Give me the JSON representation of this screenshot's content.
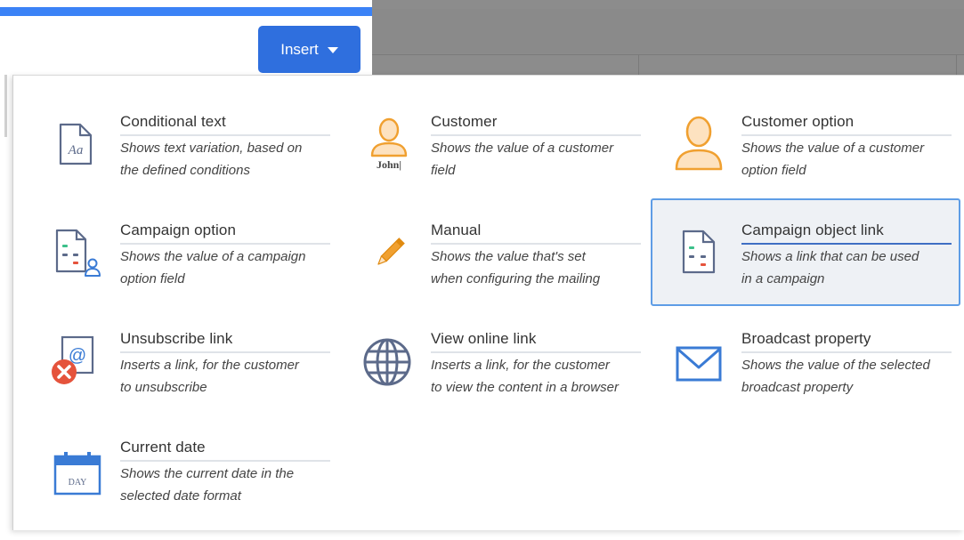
{
  "toolbar": {
    "insert_label": "Insert"
  },
  "menu": {
    "items": [
      {
        "title": "Conditional text",
        "desc_line1": "Shows text variation, based on",
        "desc_line2": "the defined conditions",
        "icon": "document-aa-icon"
      },
      {
        "title": "Customer",
        "desc_line1": "Shows the value of a customer",
        "desc_line2": "field",
        "icon": "person-name-icon",
        "icon_text": "John|"
      },
      {
        "title": "Customer option",
        "desc_line1": "Shows the value of a customer",
        "desc_line2": "option field",
        "icon": "person-icon"
      },
      {
        "title": "Campaign option",
        "desc_line1": "Shows the value of a campaign",
        "desc_line2": "option field",
        "icon": "campaign-document-user-icon"
      },
      {
        "title": "Manual",
        "desc_line1": "Shows the value that's set",
        "desc_line2": "when configuring the mailing",
        "icon": "pencil-icon"
      },
      {
        "title": "Campaign object link",
        "desc_line1": "Shows a link that can be used",
        "desc_line2": "in a campaign",
        "icon": "campaign-document-icon",
        "selected": true
      },
      {
        "title": "Unsubscribe link",
        "desc_line1": "Inserts a link, for the customer",
        "desc_line2": "to unsubscribe",
        "icon": "unsubscribe-icon"
      },
      {
        "title": "View online link",
        "desc_line1": "Inserts a link, for the customer",
        "desc_line2": "to view the content in a browser",
        "icon": "globe-icon"
      },
      {
        "title": "Broadcast property",
        "desc_line1": "Shows the value of the selected",
        "desc_line2": "broadcast property",
        "icon": "envelope-icon"
      },
      {
        "title": "Current date",
        "desc_line1": "Shows the current date in the",
        "desc_line2": "selected date format",
        "icon": "calendar-icon",
        "icon_text": "DAY"
      }
    ]
  },
  "colors": {
    "accent": "#2f6fde",
    "highlight_border": "#5e9de6",
    "icon_orange": "#f0a030",
    "icon_blue": "#3a7bd5",
    "icon_slate": "#5c6a8a"
  }
}
